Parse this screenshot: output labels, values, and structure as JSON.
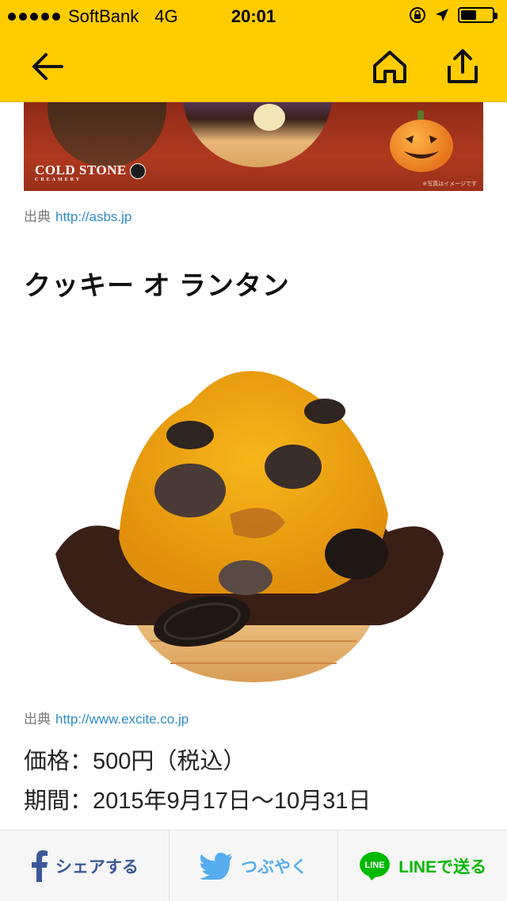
{
  "status_bar": {
    "carrier": "SoftBank",
    "network": "4G",
    "time": "20:01",
    "battery_level": 0.5
  },
  "nav": {
    "back_icon": "arrow-left-icon",
    "home_icon": "home-icon",
    "share_icon": "share-upload-icon"
  },
  "banner": {
    "logo_text": "COLD STONE",
    "logo_subtext": "CREAMERY",
    "note": "※写真はイメージです",
    "source_label": "出典",
    "source_url": "http://asbs.jp"
  },
  "article": {
    "heading": "クッキー オ ランタン",
    "image_source_label": "出典",
    "image_source_url": "http://www.excite.co.jp",
    "price": "価格：500円（税込）",
    "period": "期間：2015年9月17日〜10月31日"
  },
  "share_bar": {
    "facebook_label": "シェアする",
    "twitter_label": "つぶやく",
    "line_label": "LINEで送る",
    "line_badge": "LINE"
  },
  "colors": {
    "accent_yellow": "#ffcc00",
    "link_blue": "#2e8bc9",
    "facebook_blue": "#3b5998",
    "twitter_blue": "#55acee",
    "line_green": "#00b900"
  }
}
